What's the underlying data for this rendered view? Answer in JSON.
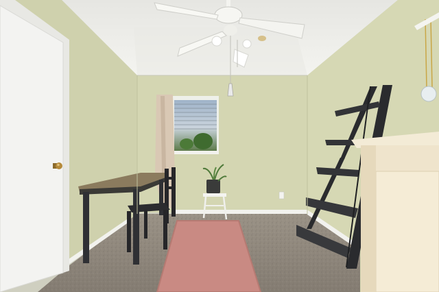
{
  "scene": {
    "colors": {
      "wall": "#d4d6b2",
      "wall_shadow": "#c6c8a4",
      "ceiling": "#eeeeea",
      "floor": "#8d857a",
      "door": "#f3f3f1",
      "rug": "#c98a83",
      "table_top": "#8b7b5e",
      "furniture_dark": "#2e2f33",
      "cabinet": "#efe4cc",
      "baseboard": "#f2f2ee"
    },
    "icons": [
      "ceiling-fan-icon",
      "window-icon",
      "door-knob-icon",
      "plant-icon",
      "leaning-ladder-shelf-icon"
    ]
  }
}
